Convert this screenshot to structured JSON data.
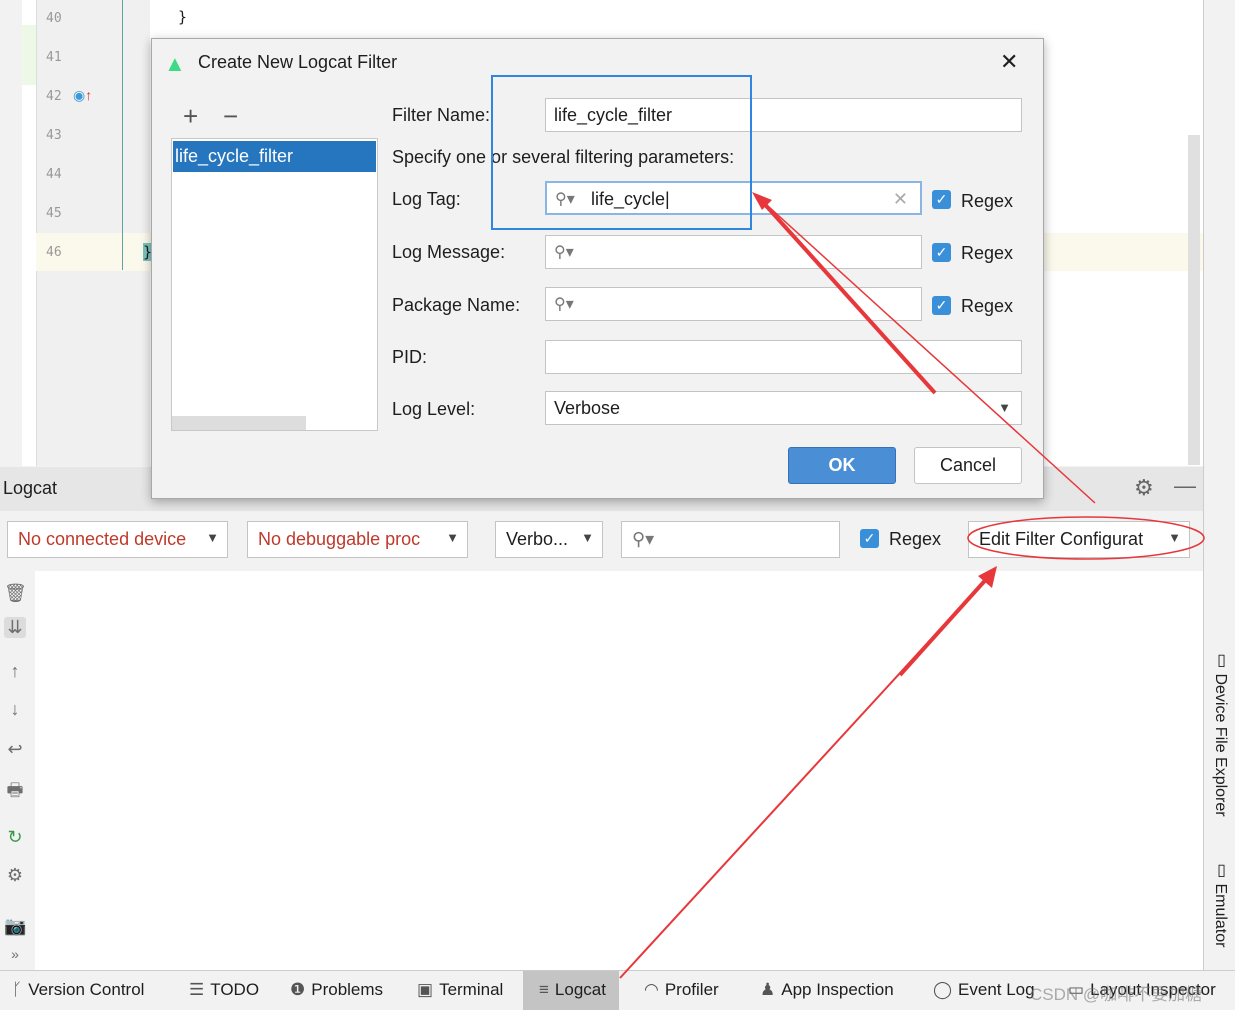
{
  "editor": {
    "line_numbers": [
      "40",
      "41",
      "42",
      "43",
      "44",
      "45",
      "46"
    ],
    "code_lines": [
      "}",
      "}"
    ]
  },
  "dialog": {
    "title": "Create New Logcat Filter",
    "add_label": "+",
    "remove_label": "−",
    "close_label": "✕",
    "filters": [
      "life_cycle_filter"
    ],
    "filter_name_label": "Filter Name:",
    "filter_name_value": "life_cycle_filter",
    "specify_text": "Specify one or several filtering parameters:",
    "log_tag_label": "Log Tag:",
    "log_tag_value": "life_cycle",
    "log_message_label": "Log Message:",
    "log_message_value": "",
    "package_name_label": "Package Name:",
    "package_name_value": "",
    "pid_label": "PID:",
    "pid_value": "",
    "log_level_label": "Log Level:",
    "log_level_value": "Verbose",
    "regex_label": "Regex",
    "regex_checked": [
      true,
      true,
      true
    ],
    "ok_label": "OK",
    "cancel_label": "Cancel"
  },
  "logcat": {
    "title": "Logcat",
    "device_select": "No connected device",
    "process_select": "No debuggable proc",
    "level_select": "Verbo...",
    "search_value": "",
    "regex_label": "Regex",
    "regex_checked": true,
    "filter_config": "Edit Filter Configurat"
  },
  "right_tools": [
    "Device File Explorer",
    "Emulator"
  ],
  "bottom_tabs": [
    {
      "label": "Version Control",
      "icon": "branch-icon"
    },
    {
      "label": "TODO",
      "icon": "list-icon"
    },
    {
      "label": "Problems",
      "icon": "warning-icon"
    },
    {
      "label": "Terminal",
      "icon": "terminal-icon"
    },
    {
      "label": "Logcat",
      "icon": "logcat-icon",
      "active": true
    },
    {
      "label": "Profiler",
      "icon": "gauge-icon"
    },
    {
      "label": "App Inspection",
      "icon": "inspect-icon"
    },
    {
      "label": "Event Log",
      "icon": "event-log-icon"
    },
    {
      "label": "Layout Inspector",
      "icon": "layout-icon"
    }
  ],
  "watermark": "CSDN @咖啡不要加糖",
  "colors": {
    "selection": "#2675bf",
    "accent": "#3a8fd9",
    "annotation_red": "#e8373a",
    "annotation_blue": "#2e86de"
  }
}
